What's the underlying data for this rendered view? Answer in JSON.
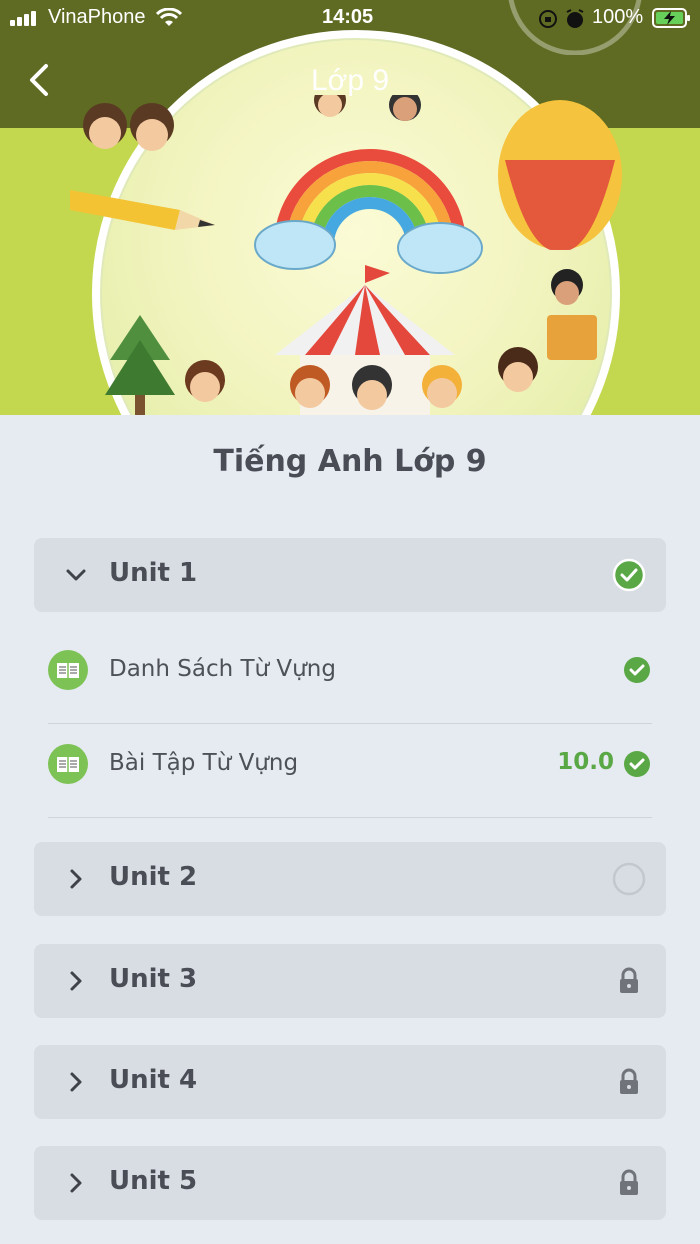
{
  "status_bar": {
    "carrier": "VinaPhone",
    "time": "14:05",
    "battery": "100%"
  },
  "nav": {
    "title": "Lớp 9"
  },
  "page": {
    "title": "Tiếng Anh Lớp 9"
  },
  "units": [
    {
      "label": "Unit 1",
      "state": "completed",
      "expanded": true
    },
    {
      "label": "Unit 2",
      "state": "not-started",
      "expanded": false
    },
    {
      "label": "Unit 3",
      "state": "locked",
      "expanded": false
    },
    {
      "label": "Unit 4",
      "state": "locked",
      "expanded": false
    },
    {
      "label": "Unit 5",
      "state": "locked",
      "expanded": false
    }
  ],
  "unit1_items": [
    {
      "label": "Danh Sách Từ Vựng",
      "score": "",
      "done": true
    },
    {
      "label": "Bài Tập Từ Vựng",
      "score": "10.0",
      "done": true
    }
  ],
  "colors": {
    "accent_green": "#5aa845",
    "unit_bg": "#d8dce3",
    "page_bg": "#e6ebf2",
    "header_bg": "#5f6b22"
  }
}
